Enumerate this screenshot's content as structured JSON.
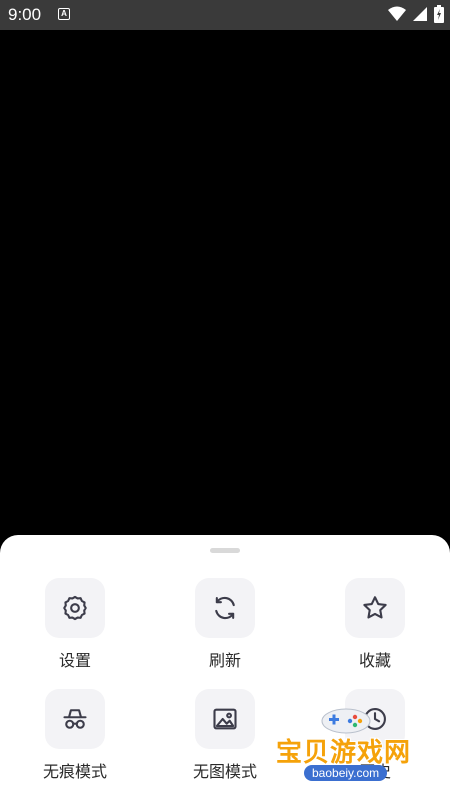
{
  "status_bar": {
    "time": "9:00",
    "notification_icon": "a-box-icon",
    "icons": [
      "wifi-icon",
      "signal-icon",
      "battery-icon"
    ]
  },
  "menu": {
    "items": [
      {
        "label": "设置",
        "icon": "gear-icon"
      },
      {
        "label": "刷新",
        "icon": "refresh-icon"
      },
      {
        "label": "收藏",
        "icon": "star-icon"
      },
      {
        "label": "无痕模式",
        "icon": "incognito-icon"
      },
      {
        "label": "无图模式",
        "icon": "image-icon"
      },
      {
        "label": "历史",
        "icon": "history-icon"
      }
    ]
  },
  "watermark": {
    "title": "宝贝游戏网",
    "url": "baobeiy.com"
  },
  "colors": {
    "status_bar": "#3a3a3a",
    "sheet": "#ffffff",
    "icon_box": "#f3f3f6",
    "icon_stroke": "#3c3c4a",
    "watermark": "#f5a20a"
  }
}
